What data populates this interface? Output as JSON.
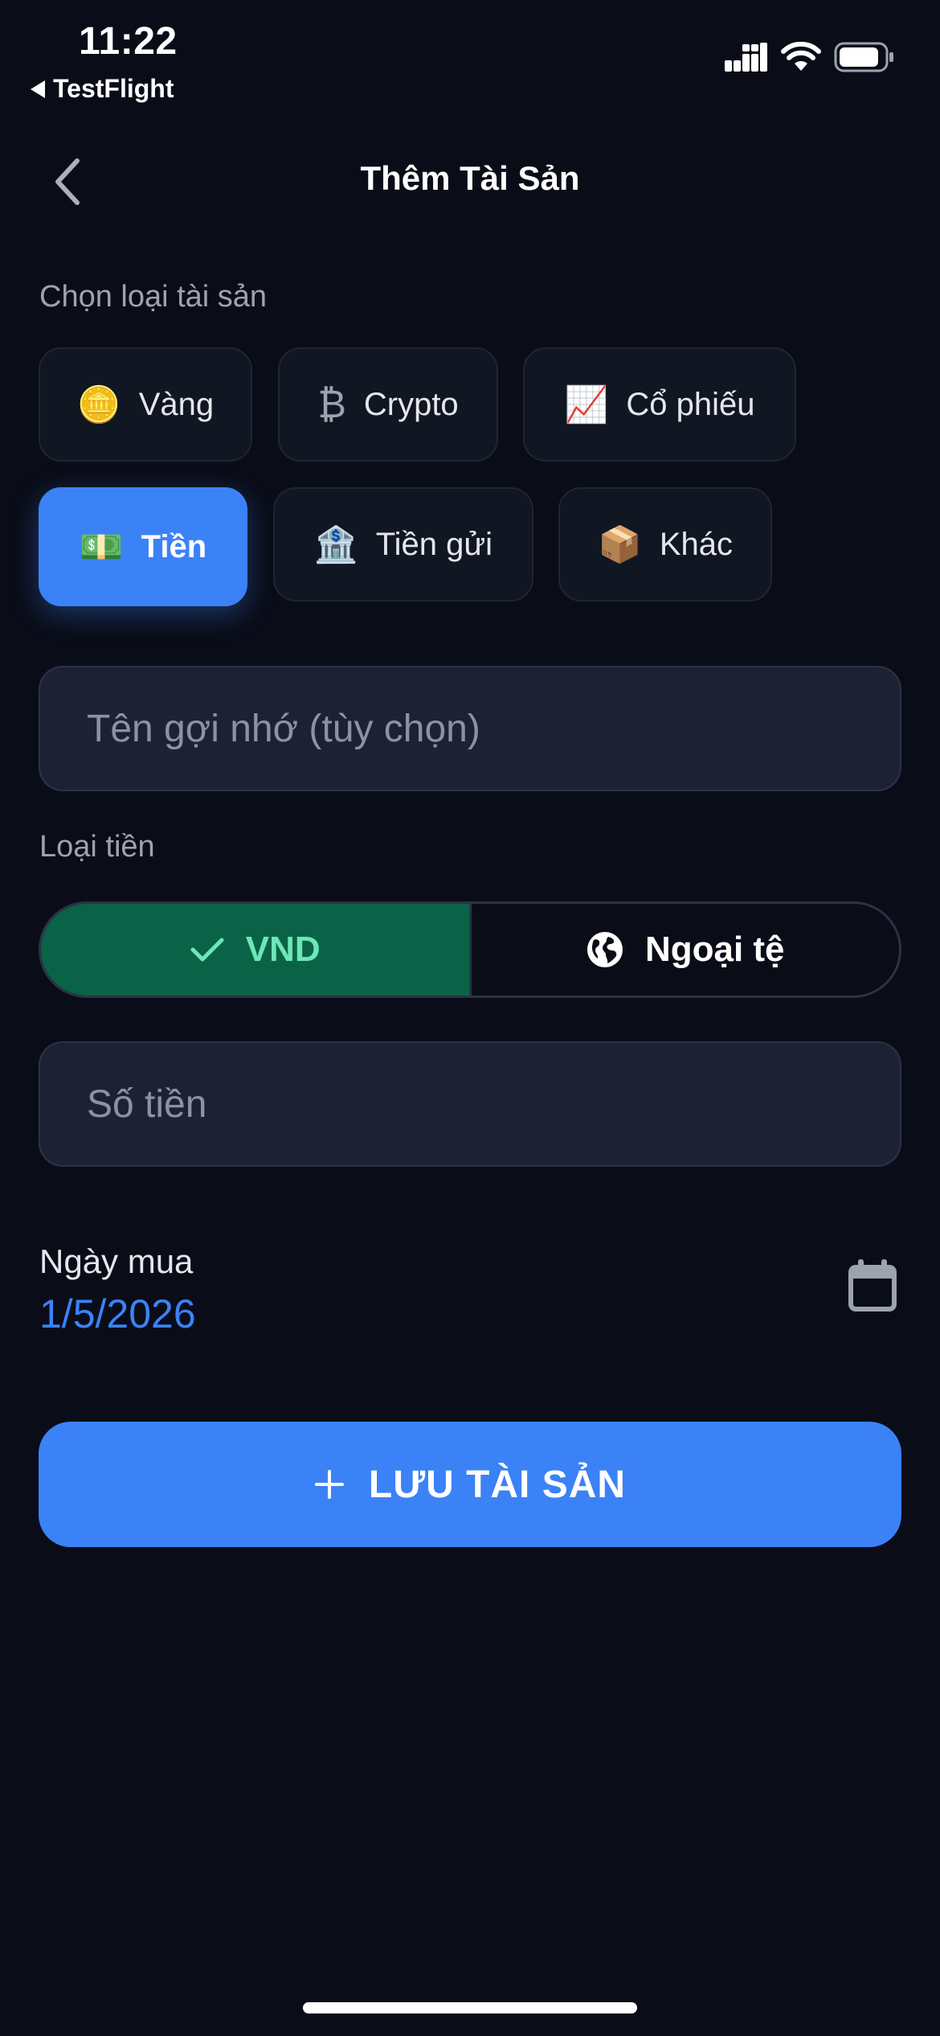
{
  "status_bar": {
    "time": "11:22",
    "back_app": "TestFlight"
  },
  "header": {
    "title": "Thêm Tài Sản"
  },
  "asset_type": {
    "label": "Chọn loại tài sản",
    "options": [
      {
        "emoji": "🪙",
        "label": "Vàng"
      },
      {
        "emoji": "₿",
        "label": "Crypto"
      },
      {
        "emoji": "📈",
        "label": "Cổ phiếu"
      },
      {
        "emoji": "💵",
        "label": "Tiền",
        "selected": true
      },
      {
        "emoji": "🏦",
        "label": "Tiền gửi"
      },
      {
        "emoji": "📦",
        "label": "Khác"
      }
    ]
  },
  "nickname": {
    "placeholder": "Tên gợi nhớ (tùy chọn)",
    "value": ""
  },
  "currency_type": {
    "label": "Loại tiền",
    "options": [
      {
        "label": "VND",
        "icon": "check-icon",
        "selected": true
      },
      {
        "label": "Ngoại tệ",
        "icon": "globe-icon",
        "selected": false
      }
    ]
  },
  "amount": {
    "placeholder": "Số tiền",
    "value": ""
  },
  "purchase_date": {
    "label": "Ngày mua",
    "value": "1/5/2026"
  },
  "save_button": {
    "label": "LƯU TÀI SẢN",
    "icon": "plus-icon"
  },
  "colors": {
    "background": "#0a0d18",
    "accent": "#3b82f6",
    "selected_green": "#0b6347",
    "selected_green_text": "#6ee7b7"
  }
}
